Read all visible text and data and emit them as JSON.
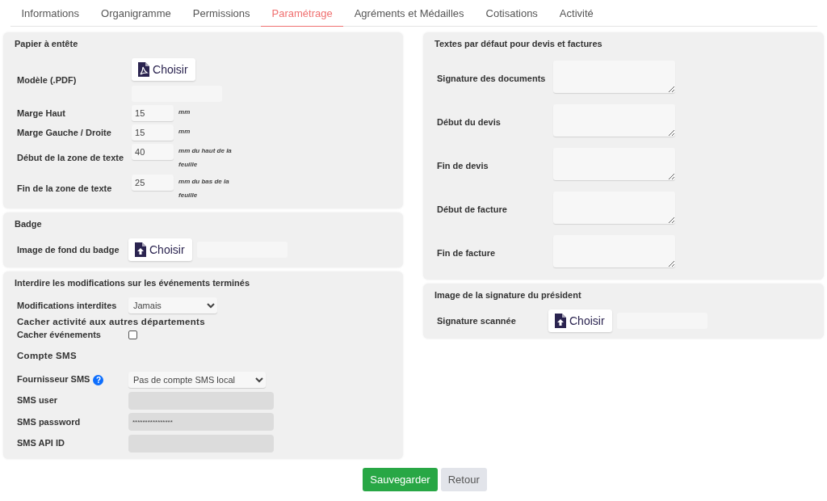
{
  "tabs": [
    {
      "label": "Informations",
      "selected": false
    },
    {
      "label": "Organigramme",
      "selected": false
    },
    {
      "label": "Permissions",
      "selected": false
    },
    {
      "label": "Paramétrage",
      "selected": true
    },
    {
      "label": "Agréments et Médailles",
      "selected": false
    },
    {
      "label": "Cotisations",
      "selected": false
    },
    {
      "label": "Activité",
      "selected": false
    }
  ],
  "left_panels": [
    {
      "title": "Papier à entête",
      "rows": [
        {
          "kind": "pdf_upload",
          "label": "Modèle (.PDF)",
          "button": "Choisir"
        },
        {
          "kind": "number",
          "label": "Marge Haut",
          "value": "15",
          "unit": "mm"
        },
        {
          "kind": "number",
          "label": "Marge Gauche / Droite",
          "value": "15",
          "unit": "mm"
        },
        {
          "kind": "number",
          "label": "Début de la zone de texte",
          "value": "40",
          "unit": "mm du haut de la feuille"
        },
        {
          "kind": "number",
          "label": "Fin de la zone de texte",
          "value": "25",
          "unit": "mm du bas de la feuille"
        }
      ]
    },
    {
      "title": "Badge",
      "rows": [
        {
          "kind": "file_upload",
          "label": "Image de fond du badge",
          "button": "Choisir"
        }
      ]
    },
    {
      "title": "Interdire les modifications sur les événements terminés",
      "rows": [
        {
          "kind": "select",
          "label": "Modifications interdites",
          "value": "Jamais"
        },
        {
          "kind": "heading",
          "text": "Cacher activité aux autres départements"
        },
        {
          "kind": "checkbox",
          "label": "Cacher événements",
          "checked": false
        },
        {
          "kind": "heading",
          "text": "Compte SMS"
        },
        {
          "kind": "select",
          "label": "Fournisseur SMS",
          "value": "Pas de compte SMS local",
          "help_icon": "?"
        },
        {
          "kind": "text",
          "label": "SMS user",
          "value": "",
          "disabled": true
        },
        {
          "kind": "text",
          "label": "SMS password",
          "value": "****************",
          "disabled": true
        },
        {
          "kind": "text",
          "label": "SMS API ID",
          "value": "",
          "disabled": true
        }
      ]
    }
  ],
  "right_panels": [
    {
      "title": "Textes par défaut pour devis et factures",
      "rows": [
        {
          "kind": "textarea",
          "label": "Signature des documents"
        },
        {
          "kind": "textarea",
          "label": "Début du devis"
        },
        {
          "kind": "textarea",
          "label": "Fin de devis"
        },
        {
          "kind": "textarea",
          "label": "Début de facture"
        },
        {
          "kind": "textarea",
          "label": "Fin de facture"
        }
      ]
    },
    {
      "title": "Image de la signature du président",
      "rows": [
        {
          "kind": "file_upload",
          "label": "Signature scannée",
          "button": "Choisir"
        }
      ]
    }
  ],
  "buttons": [
    {
      "label": "Sauvegarder",
      "kind": "primary"
    },
    {
      "label": "Retour",
      "kind": "secondary"
    }
  ]
}
